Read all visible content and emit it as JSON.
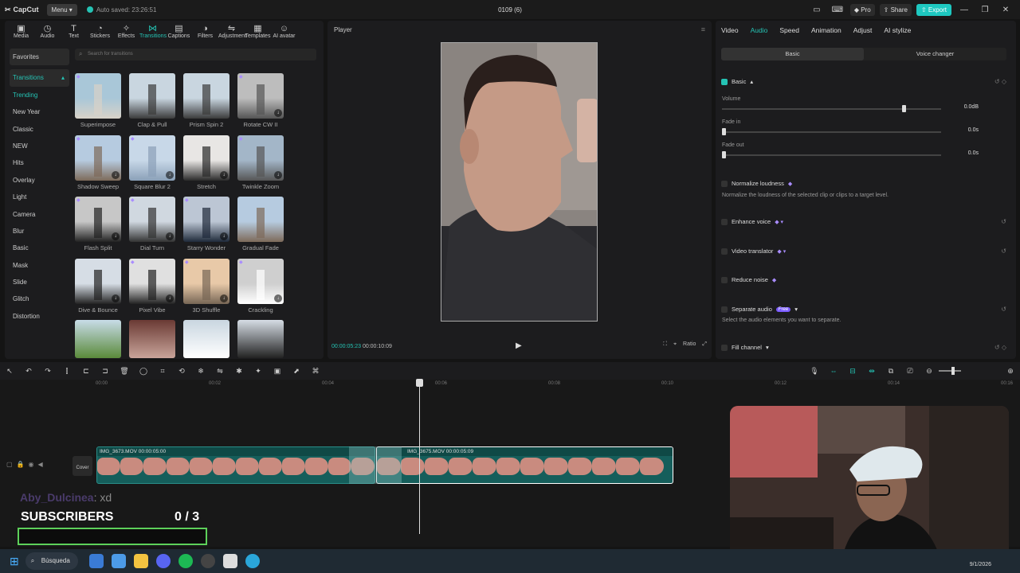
{
  "titlebar": {
    "app": "CapCut",
    "menu": "Menu",
    "autosave": "Auto saved: 23:26:51",
    "project": "0109 (6)",
    "pro": "Pro",
    "share": "Share",
    "export": "Export"
  },
  "tools": [
    {
      "label": "Media",
      "icon": "media-icon"
    },
    {
      "label": "Audio",
      "icon": "audio-icon"
    },
    {
      "label": "Text",
      "icon": "text-icon"
    },
    {
      "label": "Stickers",
      "icon": "sticker-icon"
    },
    {
      "label": "Effects",
      "icon": "effects-icon"
    },
    {
      "label": "Transitions",
      "icon": "transitions-icon"
    },
    {
      "label": "Captions",
      "icon": "captions-icon"
    },
    {
      "label": "Filters",
      "icon": "filters-icon"
    },
    {
      "label": "Adjustment",
      "icon": "adjustment-icon"
    },
    {
      "label": "Templates",
      "icon": "templates-icon"
    },
    {
      "label": "AI avatar",
      "icon": "ai-avatar-icon"
    }
  ],
  "categories": [
    "Favorites",
    "Transitions",
    "Trending",
    "New Year",
    "Classic",
    "NEW",
    "Hits",
    "Overlay",
    "Light",
    "Camera",
    "Blur",
    "Basic",
    "Mask",
    "Slide",
    "Glitch",
    "Distortion"
  ],
  "search_placeholder": "Search for transitions",
  "transitions": [
    "Superimpose",
    "Clap & Pull",
    "Prism Spin 2",
    "Rotate CW II",
    "Shadow Sweep",
    "Square Blur 2",
    "Stretch",
    "Twinkle Zoom",
    "Flash Split",
    "Dial Turn",
    "Starry Wonder",
    "Gradual Fade",
    "Dive & Bounce",
    "Pixel Vibe",
    "3D Shuffle",
    "Crackling"
  ],
  "player": {
    "title": "Player",
    "current": "00:00:05:23",
    "total": "00:00:10:09",
    "ratio": "Ratio"
  },
  "props": {
    "tabs": [
      "Video",
      "Audio",
      "Speed",
      "Animation",
      "Adjust",
      "AI stylize"
    ],
    "seg": [
      "Basic",
      "Voice changer"
    ],
    "basic": "Basic",
    "volume": "Volume",
    "volume_val": "0.0dB",
    "volume_level": 0.82,
    "fade_in": "Fade in",
    "fade_in_val": "0.0s",
    "fade_out": "Fade out",
    "fade_out_val": "0.0s",
    "normalize": "Normalize loudness",
    "normalize_desc": "Normalize the loudness of the selected clip or clips to a target level.",
    "enhance": "Enhance voice",
    "translator": "Video translator",
    "reduce": "Reduce noise",
    "separate": "Separate audio",
    "free": "Free",
    "separate_desc": "Select the audio elements you want to separate.",
    "fill": "Fill channel"
  },
  "timeline": {
    "ticks": [
      "00:00",
      "00:02",
      "00:04",
      "00:06",
      "00:08",
      "00:10",
      "00:12",
      "00:14",
      "00:16"
    ],
    "clip1": "IMG_3673.MOV   00:00:05:00",
    "clip2": "IMG_3675.MOV   00:00:05:09",
    "cover": "Cover"
  },
  "overlay": {
    "chat_user": "Aby_Dulcinea",
    "chat_msg": ": xd",
    "subs_label": "SUBSCRIBERS",
    "subs_count": "0  / 3"
  },
  "taskbar": {
    "search": "Búsqueda",
    "date": "9/1/2026"
  },
  "colors": {
    "accent": "#25c3b4",
    "bg": "#141414",
    "panel": "#1c1c1e"
  }
}
